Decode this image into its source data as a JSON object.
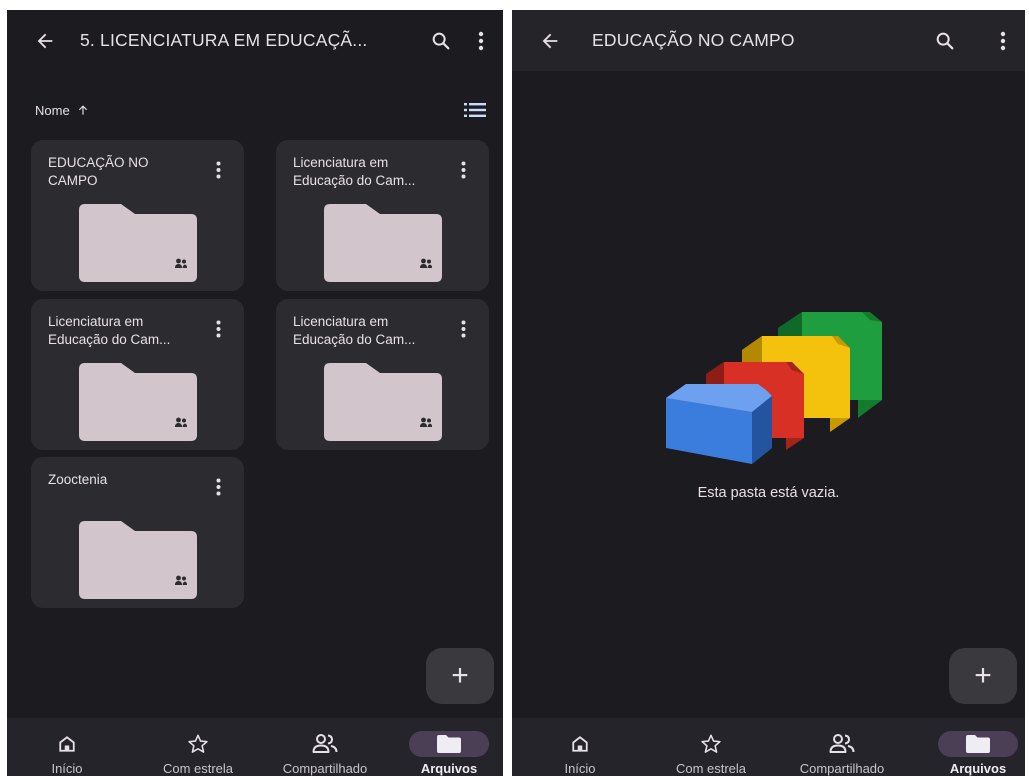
{
  "left": {
    "title": "5. LICENCIATURA EM EDUCAÇÃ...",
    "sort_label": "Nome",
    "folders": [
      {
        "name": "EDUCAÇÃO NO CAMPO"
      },
      {
        "name": "Licenciatura em Educação do Cam..."
      },
      {
        "name": "Licenciatura em Educação do Cam..."
      },
      {
        "name": "Licenciatura em Educação do Cam..."
      },
      {
        "name": "Zooctenia"
      }
    ],
    "fab_label": "+"
  },
  "right": {
    "title": "EDUCAÇÃO NO CAMPO",
    "empty_message": "Esta pasta está vazia.",
    "fab_label": "+"
  },
  "nav": {
    "items": [
      "Início",
      "Com estrela",
      "Compartilhado",
      "Arquivos"
    ],
    "active": "Arquivos"
  },
  "icons": [
    "back-arrow-icon",
    "search-icon",
    "more-vert-icon",
    "sort-arrow-up-icon",
    "list-view-icon",
    "folder-icon",
    "shared-people-icon",
    "home-icon",
    "star-icon",
    "people-icon",
    "empty-folder-illustration"
  ],
  "colors": {
    "background": "#1c1b1f",
    "card": "#2c2b30",
    "folder_fill": "#d2c6cc",
    "nav_bar": "#25242a",
    "active_pill": "#4b3f56",
    "illustration_blue": "#3b7ddd",
    "illustration_red": "#d93025",
    "illustration_yellow": "#f4c20d",
    "illustration_green": "#1e9e3e"
  }
}
